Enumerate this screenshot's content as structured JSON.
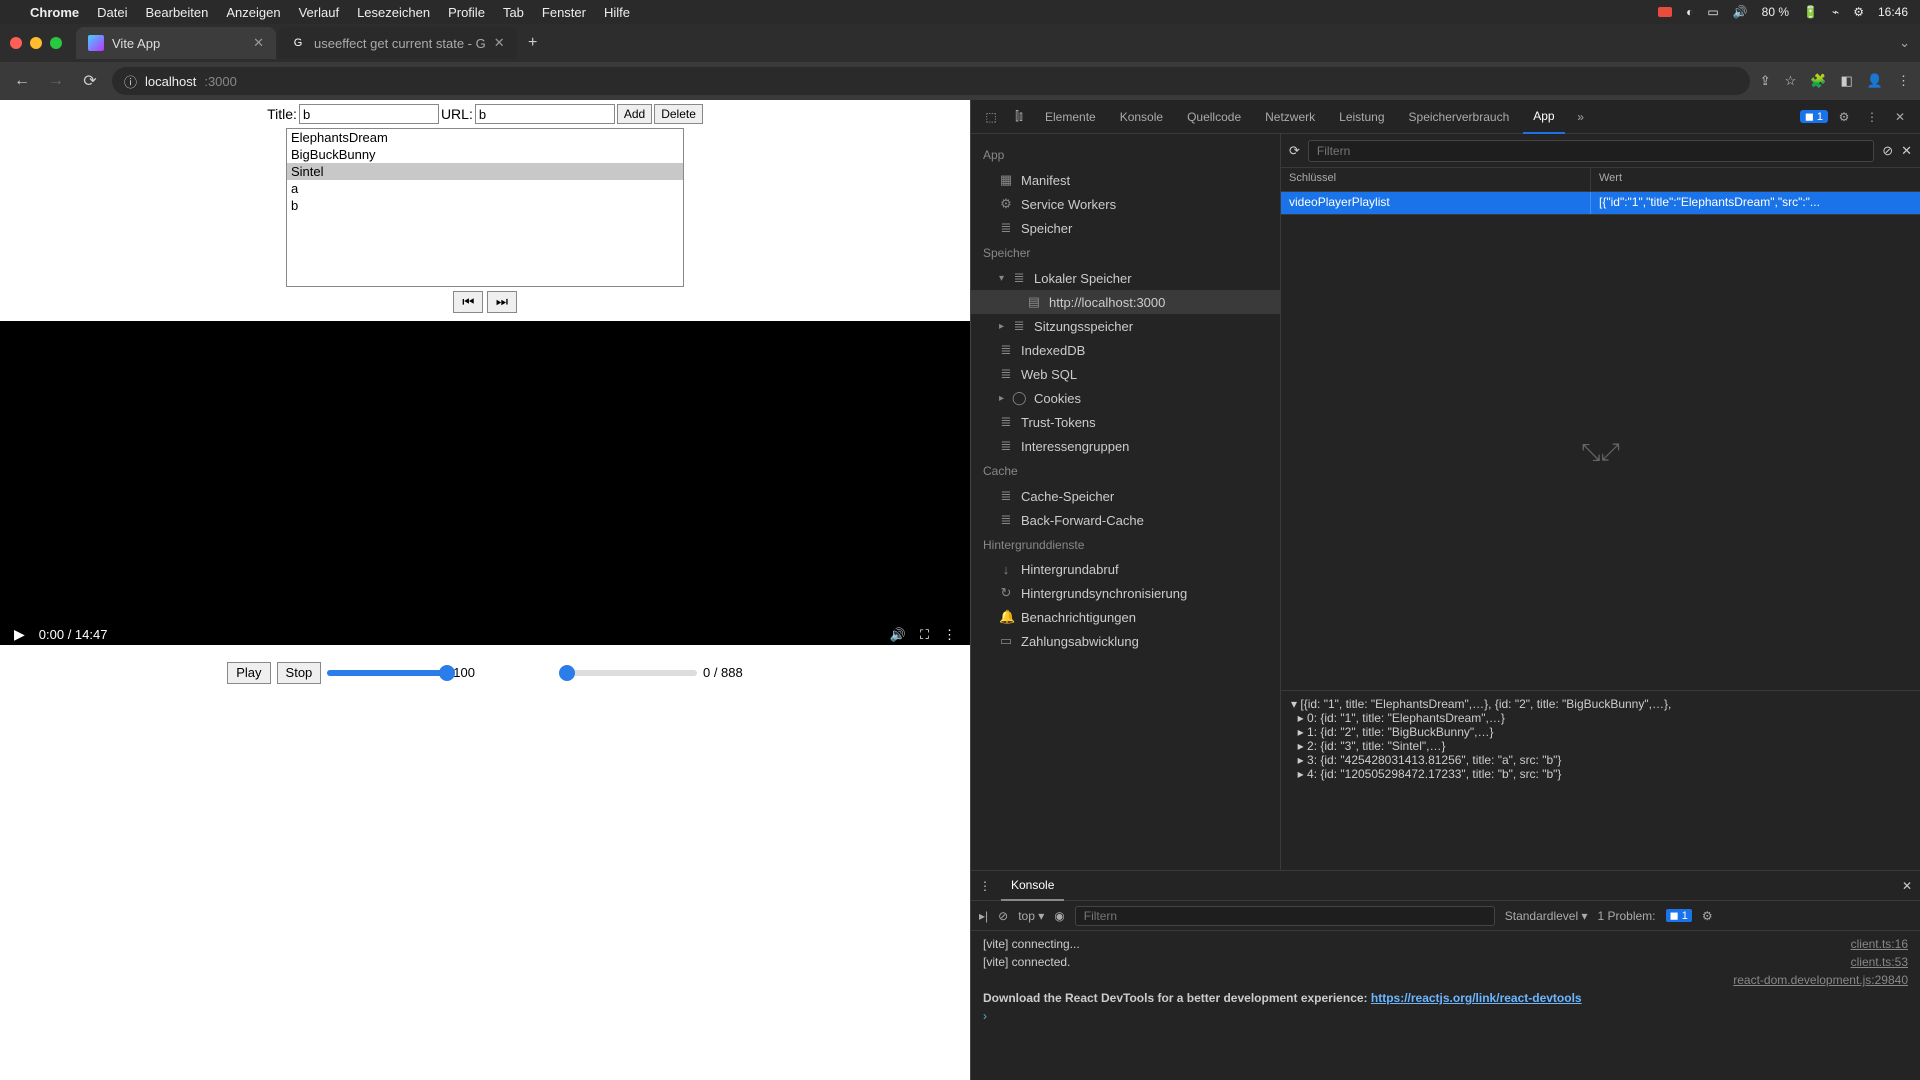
{
  "menubar": {
    "app": "Chrome",
    "items": [
      "Datei",
      "Bearbeiten",
      "Anzeigen",
      "Verlauf",
      "Lesezeichen",
      "Profile",
      "Tab",
      "Fenster",
      "Hilfe"
    ],
    "battery": "80 %",
    "clock": "16:46"
  },
  "tabs": {
    "tab1": "Vite App",
    "tab2": "useeffect get current state - G"
  },
  "urlbar": {
    "host": "localhost",
    "port": ":3000"
  },
  "form": {
    "title_label": "Title:",
    "title_value": "b",
    "url_label": "URL:",
    "url_value": "b",
    "add": "Add",
    "delete": "Delete"
  },
  "playlist": [
    "ElephantsDream",
    "BigBuckBunny",
    "Sintel",
    "a",
    "b"
  ],
  "playlist_selected_index": 2,
  "nav": {
    "prev": "⏮",
    "next": "⏭"
  },
  "video": {
    "time": "0:00 / 14:47"
  },
  "custom": {
    "play": "Play",
    "stop": "Stop",
    "vol": "100",
    "pos": "0 / 888"
  },
  "devtools": {
    "tabs": [
      "Elemente",
      "Konsole",
      "Quellcode",
      "Netzwerk",
      "Leistung",
      "Speicherverbrauch",
      "App"
    ],
    "active_tab": "App",
    "issues_count": "1",
    "sidebar": {
      "app": "App",
      "manifest": "Manifest",
      "service_workers": "Service Workers",
      "speicher": "Speicher",
      "speicher_h": "Speicher",
      "lokaler": "Lokaler Speicher",
      "origin": "http://localhost:3000",
      "sitzung": "Sitzungsspeicher",
      "indexeddb": "IndexedDB",
      "websql": "Web SQL",
      "cookies": "Cookies",
      "trust": "Trust-Tokens",
      "interessen": "Interessengruppen",
      "cache_h": "Cache",
      "cache_sp": "Cache-Speicher",
      "bfc": "Back-Forward-Cache",
      "hintergrund_h": "Hintergrunddienste",
      "hintergrundabruf": "Hintergrundabruf",
      "hsync": "Hintergrundsynchronisierung",
      "benach": "Benachrichtigungen",
      "zahlung": "Zahlungsabwicklung"
    },
    "filter_placeholder": "Filtern",
    "col_key": "Schlüssel",
    "col_val": "Wert",
    "storage_key": "videoPlayerPlaylist",
    "storage_val": "[{\"id\":\"1\",\"title\":\"ElephantsDream\",\"src\":\"...",
    "preview": {
      "l0": "▾ [{id: \"1\", title: \"ElephantsDream\",…}, {id: \"2\", title: \"BigBuckBunny\",…},",
      "l1": "  ▸ 0: {id: \"1\", title: \"ElephantsDream\",…}",
      "l2": "  ▸ 1: {id: \"2\", title: \"BigBuckBunny\",…}",
      "l3": "  ▸ 2: {id: \"3\", title: \"Sintel\",…}",
      "l4": "  ▸ 3: {id: \"425428031413.81256\", title: \"a\", src: \"b\"}",
      "l5": "  ▸ 4: {id: \"120505298472.17233\", title: \"b\", src: \"b\"}"
    }
  },
  "console": {
    "title": "Konsole",
    "top": "top",
    "filter_placeholder": "Filtern",
    "level": "Standardlevel",
    "problem": "1 Problem:",
    "problem_count": "1",
    "lines": [
      {
        "msg": "[vite] connecting...",
        "src": "client.ts:16"
      },
      {
        "msg": "[vite] connected.",
        "src": "client.ts:53"
      },
      {
        "msg": "",
        "src": "react-dom.development.js:29840"
      },
      {
        "msg_prefix": "Download the React DevTools for a better development experience: ",
        "link": "https://reactjs.org/link/react-devtools"
      }
    ]
  }
}
